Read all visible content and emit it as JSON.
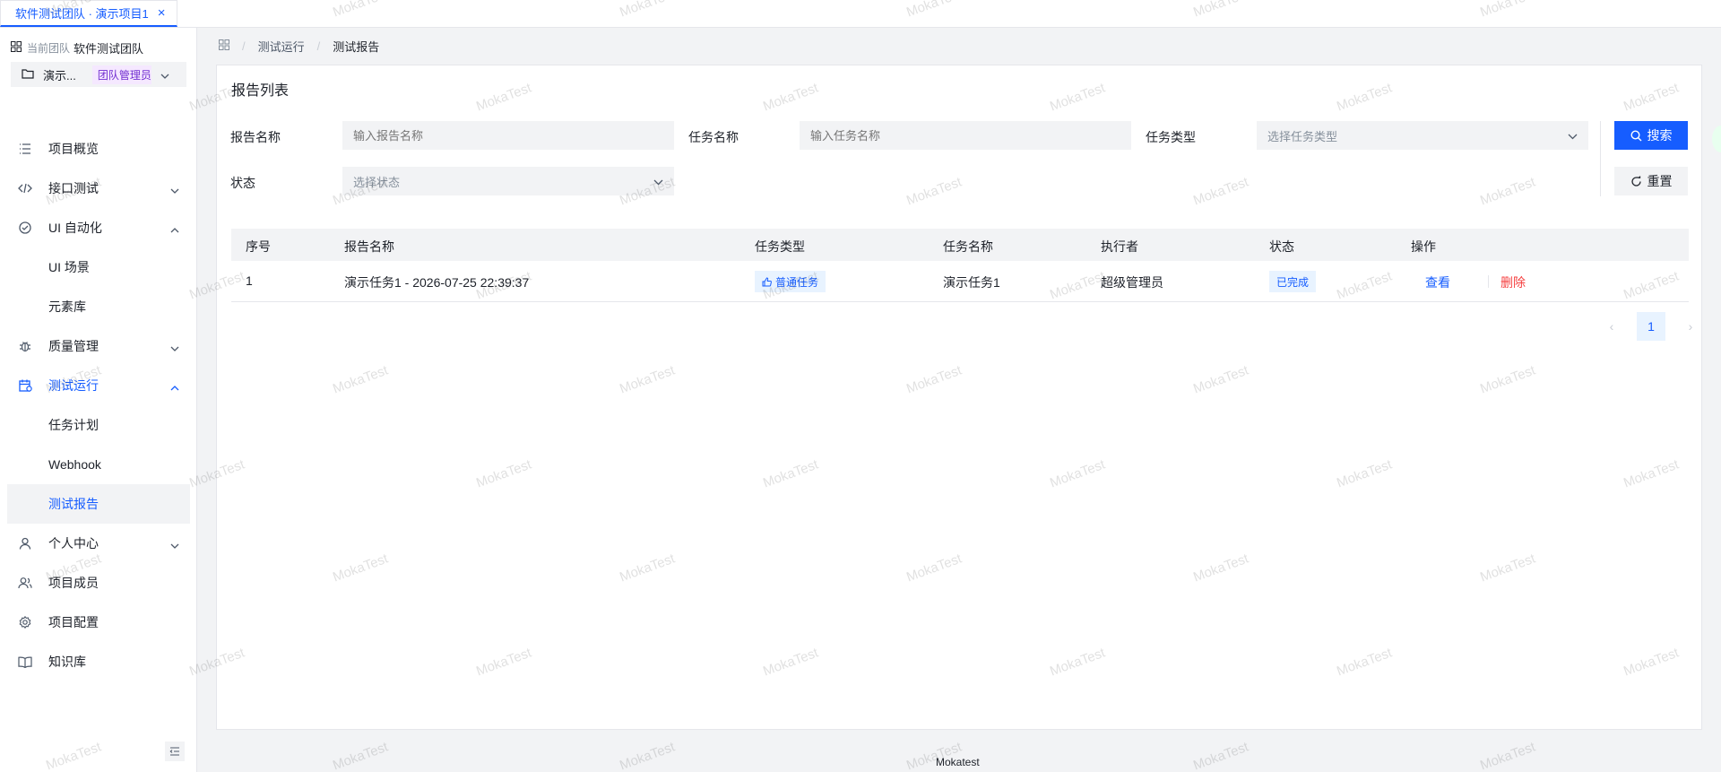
{
  "tab": {
    "label": "软件测试团队 · 演示项目1",
    "close": "×"
  },
  "sidebar": {
    "team_prefix": "当前团队",
    "team_name": "软件测试团队",
    "project_name": "演示...",
    "project_role": "团队管理员",
    "items": [
      {
        "label": "项目概览",
        "icon": "list-icon"
      },
      {
        "label": "接口测试",
        "icon": "code-icon",
        "expandable": true
      },
      {
        "label": "UI 自动化",
        "icon": "check-circle-icon",
        "expanded": true
      },
      {
        "label": "UI 场景",
        "sub": true
      },
      {
        "label": "元素库",
        "sub": true
      },
      {
        "label": "质量管理",
        "icon": "bug-icon",
        "expandable": true
      },
      {
        "label": "测试运行",
        "icon": "calendar-run-icon",
        "expanded": true,
        "active": true
      },
      {
        "label": "任务计划",
        "sub": true
      },
      {
        "label": "Webhook",
        "sub": true
      },
      {
        "label": "测试报告",
        "sub": true,
        "selected": true
      },
      {
        "label": "个人中心",
        "icon": "user-icon",
        "expandable": true
      },
      {
        "label": "项目成员",
        "icon": "user-group-icon"
      },
      {
        "label": "项目配置",
        "icon": "gear-icon"
      },
      {
        "label": "知识库",
        "icon": "book-icon"
      }
    ]
  },
  "breadcrumb": {
    "parent": "测试运行",
    "current": "测试报告"
  },
  "card": {
    "title": "报告列表"
  },
  "filters": {
    "report_name_label": "报告名称",
    "report_name_placeholder": "输入报告名称",
    "task_name_label": "任务名称",
    "task_name_placeholder": "输入任务名称",
    "task_type_label": "任务类型",
    "task_type_placeholder": "选择任务类型",
    "status_label": "状态",
    "status_placeholder": "选择状态",
    "search_label": "搜索",
    "reset_label": "重置"
  },
  "table": {
    "headers": [
      "序号",
      "报告名称",
      "任务类型",
      "任务名称",
      "执行者",
      "状态",
      "操作"
    ],
    "rows": [
      {
        "index": "1",
        "report_name": "演示任务1 - 2026-07-25 22:39:37",
        "task_type": "普通任务",
        "task_name": "演示任务1",
        "executor": "超级管理员",
        "status": "已完成",
        "view": "查看",
        "delete": "删除"
      }
    ]
  },
  "pagination": {
    "current": "1",
    "prev": "‹",
    "next": "›"
  },
  "footer": {
    "text": "Mokatest"
  },
  "watermark": {
    "text": "MokaTest",
    "text_alt": "Mokatest"
  },
  "colors": {
    "primary": "#165dff",
    "danger": "#f53f3f",
    "role_purple": "#722ed1"
  }
}
